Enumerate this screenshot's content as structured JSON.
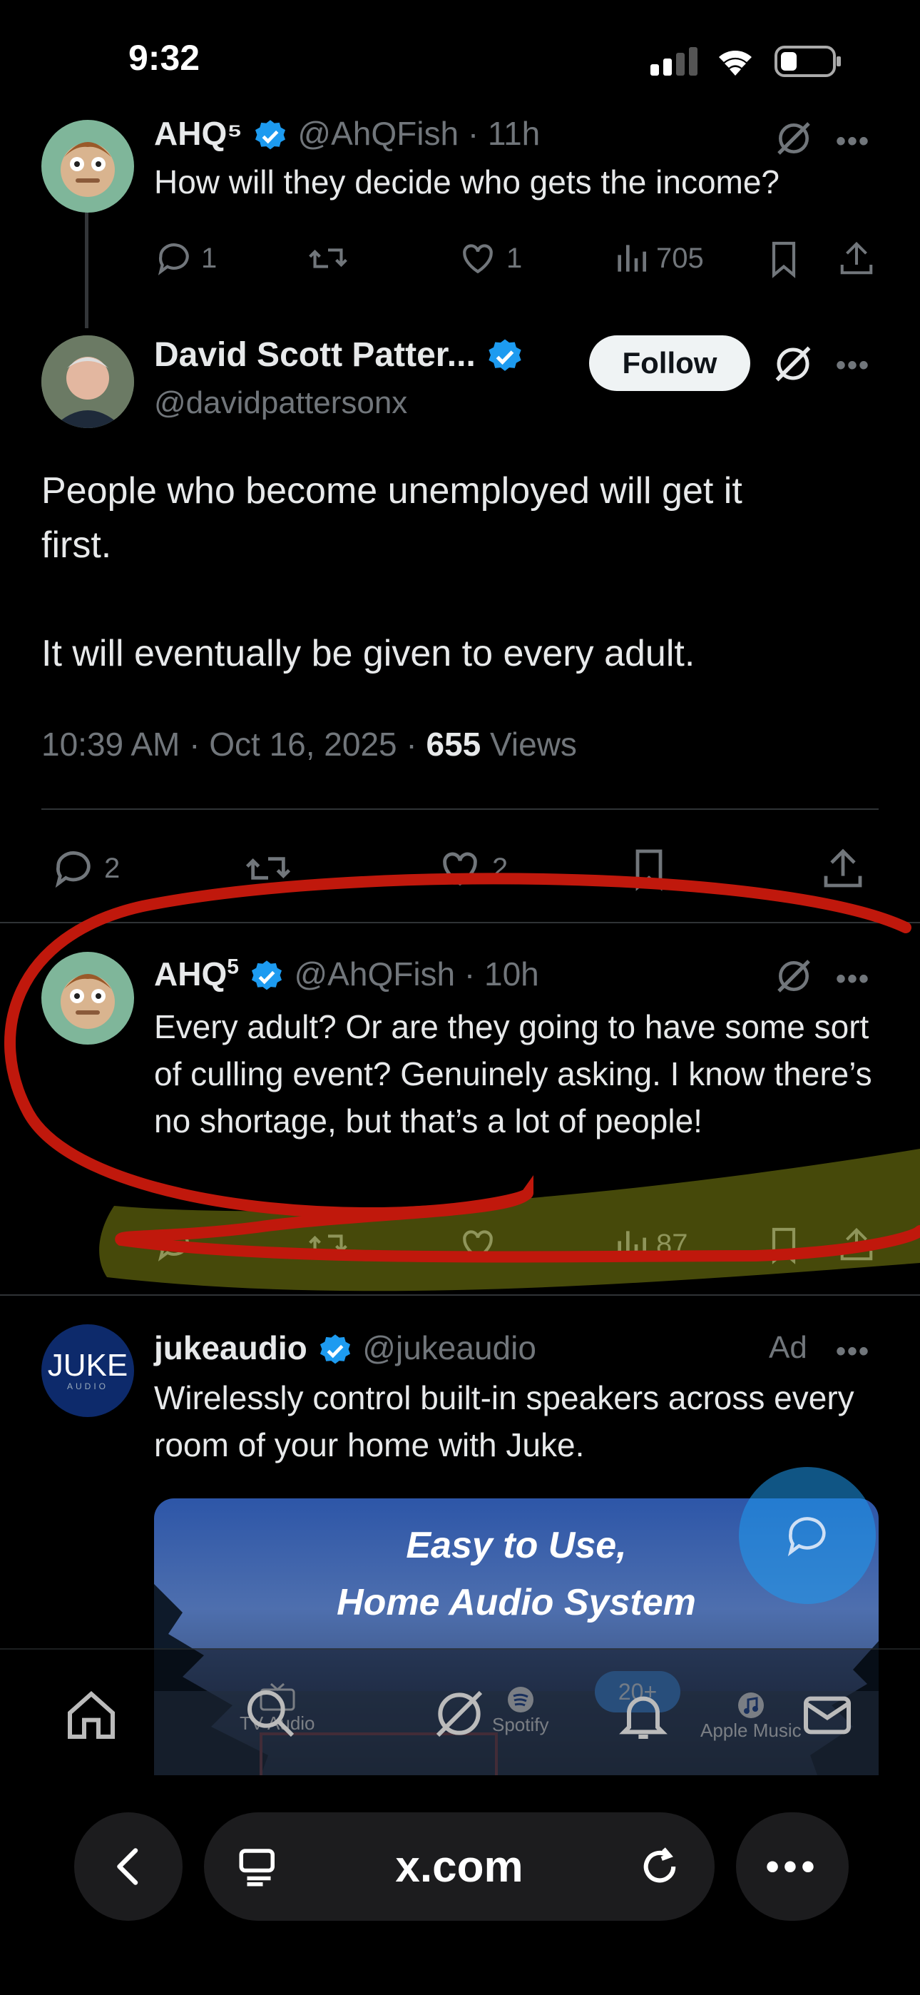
{
  "status": {
    "time": "9:32"
  },
  "tweet_prev": {
    "name": "AHQ⁵",
    "handle_time": "@AhQFish · 11h",
    "text": "How will they decide who gets the income?",
    "replies": "1",
    "likes": "1",
    "views": "705"
  },
  "tweet_main": {
    "name": "David Scott Patter...",
    "handle": "@davidpattersonx",
    "follow_label": "Follow",
    "text_line1": "People who become unemployed will get it",
    "text_line2": "first.",
    "text_line3": "It will eventually be given to every adult.",
    "meta_time": "10:39 AM · Oct 16, 2025 · ",
    "views_count": "655",
    "views_label": " Views",
    "replies": "2",
    "likes": "2"
  },
  "tweet_reply": {
    "name": "AHQ",
    "name_sup": "5",
    "handle_time": "@AhQFish · 10h",
    "text": "Every adult? Or are they going to have some sort of culling event? Genuinely asking. I know there’s no shortage, but that’s a lot of people!",
    "views": "87"
  },
  "tweet_ad": {
    "avatar_text": "JUKE",
    "avatar_sub": "AUDIO",
    "name": "jukeaudio",
    "handle": "@jukeaudio",
    "ad_label": "Ad",
    "text": "Wirelessly control built-in speakers across every room of your home with Juke.",
    "image_title_line1": "Easy to Use,",
    "image_title_line2": "Home Audio System",
    "image_labels": [
      "TV Audio",
      "Spotify",
      "20+",
      "Apple Music"
    ]
  },
  "browser": {
    "url": "x.com"
  },
  "colors": {
    "accent_blue": "#1d9bf0",
    "annotation_red": "#c0180c",
    "annotation_yellow": "#c8d21e",
    "background": "#000000"
  }
}
